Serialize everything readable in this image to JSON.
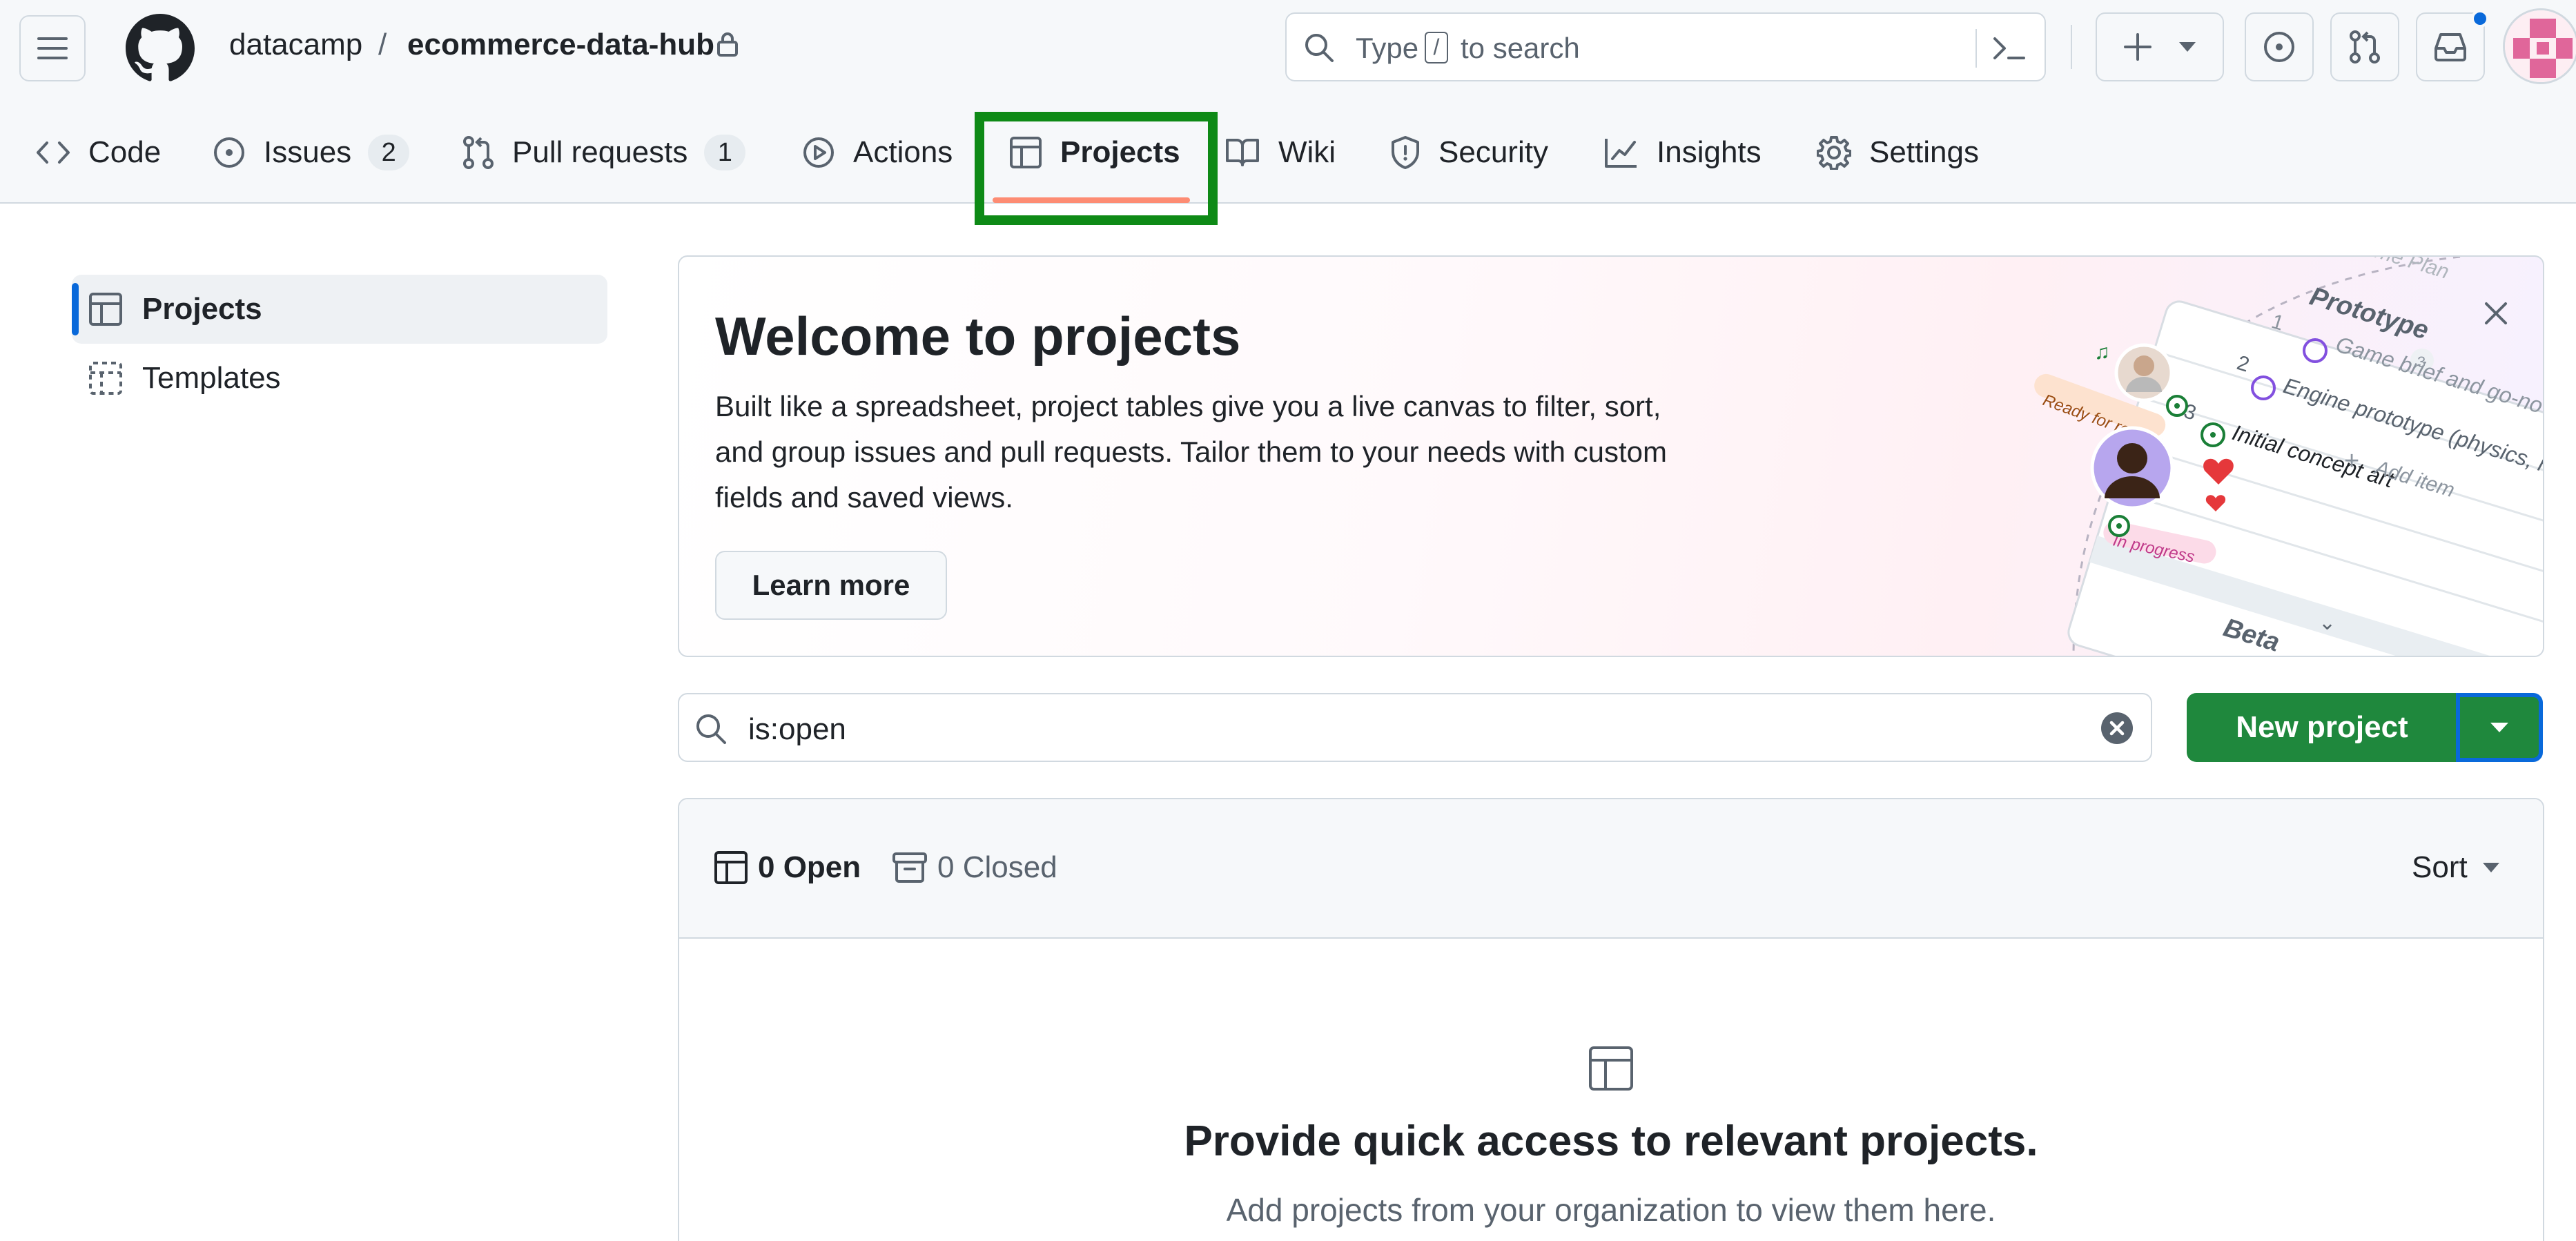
{
  "header": {
    "repo_owner": "datacamp",
    "repo_separator": "/",
    "repo_name": "ecommerce-data-hub",
    "search": {
      "prefix": "Type",
      "key": "/",
      "suffix": "to search"
    }
  },
  "tabs": [
    {
      "label": "Code",
      "icon": "code-icon"
    },
    {
      "label": "Issues",
      "icon": "issue-opened-icon",
      "count": "2"
    },
    {
      "label": "Pull requests",
      "icon": "git-pull-request-icon",
      "count": "1"
    },
    {
      "label": "Actions",
      "icon": "play-icon"
    },
    {
      "label": "Projects",
      "icon": "table-icon",
      "selected": true
    },
    {
      "label": "Wiki",
      "icon": "book-icon"
    },
    {
      "label": "Security",
      "icon": "shield-icon"
    },
    {
      "label": "Insights",
      "icon": "graph-icon"
    },
    {
      "label": "Settings",
      "icon": "gear-icon"
    }
  ],
  "sidebar": {
    "items": [
      {
        "label": "Projects",
        "icon": "table-icon",
        "selected": true
      },
      {
        "label": "Templates",
        "icon": "project-template-icon"
      }
    ]
  },
  "banner": {
    "title": "Welcome to projects",
    "description": "Built like a spreadsheet, project tables give you a live canvas to filter, sort, and group issues and pull requests. Tailor them to your needs with custom fields and saved views.",
    "button": "Learn more",
    "illustration": {
      "ready_label": "Ready for review",
      "progress_label": "In progress",
      "group_prototype": "Prototype",
      "group_beta": "Beta",
      "rows": [
        {
          "num": "1",
          "text": "Game brief and go-no"
        },
        {
          "num": "2",
          "text": "Engine prototype (physics, renderin"
        },
        {
          "num": "3",
          "text": "Initial concept art"
        }
      ],
      "add_item": "Add item",
      "prototype_count": "3",
      "top_fragment": "me Plan"
    }
  },
  "filter": {
    "value": "is:open"
  },
  "actions": {
    "new_project": "New project"
  },
  "list": {
    "open_label": "0 Open",
    "closed_label": "0 Closed",
    "sort_label": "Sort",
    "empty_title": "Provide quick access to relevant projects.",
    "empty_description": "Add projects from your organization to view them here."
  },
  "colors": {
    "primary_button": "#1f883d",
    "selected_tab_underline": "#fd8c73",
    "annotation_highlight": "#0e8a16",
    "focus_ring": "#0969da"
  }
}
